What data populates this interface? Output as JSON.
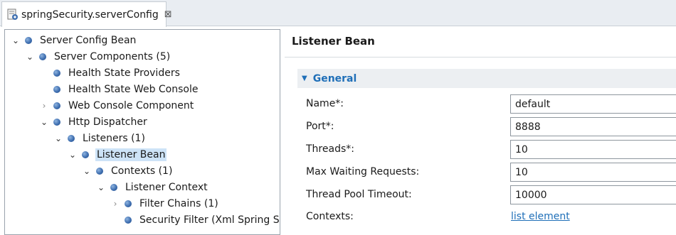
{
  "editor_tab": {
    "label": "springSecurity.serverConfig",
    "close_glyph": "⊠"
  },
  "tree": {
    "items": [
      {
        "label": "Server Config Bean",
        "state": "expanded"
      },
      {
        "label": "Server Components (5)",
        "state": "expanded"
      },
      {
        "label": "Health State Providers",
        "state": "leaf"
      },
      {
        "label": "Health State Web Console",
        "state": "leaf"
      },
      {
        "label": "Web Console Component",
        "state": "collapsed"
      },
      {
        "label": "Http Dispatcher",
        "state": "expanded"
      },
      {
        "label": "Listeners (1)",
        "state": "expanded"
      },
      {
        "label": "Listener Bean",
        "state": "expanded",
        "selected": true
      },
      {
        "label": "Contexts (1)",
        "state": "expanded"
      },
      {
        "label": "Listener Context",
        "state": "expanded"
      },
      {
        "label": "Filter Chains (1)",
        "state": "collapsed"
      },
      {
        "label": "Security Filter (Xml Spring Sec",
        "state": "leaf"
      }
    ]
  },
  "details": {
    "title": "Listener Bean",
    "section": {
      "title": "General"
    },
    "fields": {
      "name": {
        "label": "Name*:",
        "value": "default"
      },
      "port": {
        "label": "Port*:",
        "value": "8888"
      },
      "threads": {
        "label": "Threads*:",
        "value": "10"
      },
      "max_waiting": {
        "label": "Max Waiting Requests:",
        "value": "10"
      },
      "pool_timeout": {
        "label": "Thread Pool Timeout:",
        "value": "10000"
      },
      "contexts": {
        "label": "Contexts:",
        "link": "list element"
      }
    }
  },
  "colors": {
    "accent": "#1f6fb8",
    "selection": "#cde3f7",
    "bullet": "#3f6fb0"
  }
}
